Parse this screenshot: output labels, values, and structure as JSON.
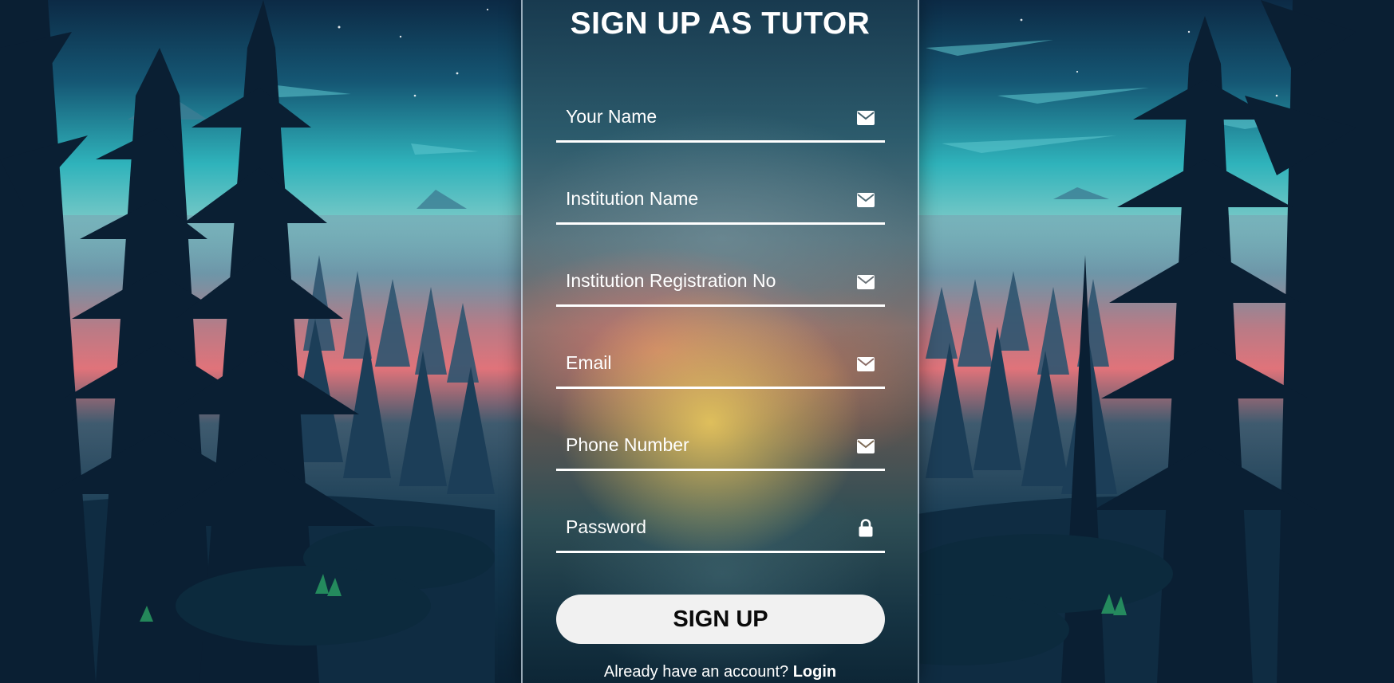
{
  "form": {
    "title": "SIGN UP AS TUTOR",
    "fields": [
      {
        "placeholder": "Your Name",
        "icon": "envelope-icon",
        "type": "text"
      },
      {
        "placeholder": "Institution Name",
        "icon": "envelope-icon",
        "type": "text"
      },
      {
        "placeholder": "Institution Registration No",
        "icon": "envelope-icon",
        "type": "text"
      },
      {
        "placeholder": "Email",
        "icon": "envelope-icon",
        "type": "email"
      },
      {
        "placeholder": "Phone Number",
        "icon": "envelope-icon",
        "type": "tel"
      },
      {
        "placeholder": "Password",
        "icon": "lock-icon",
        "type": "password"
      }
    ],
    "submit_label": "SIGN UP",
    "login_prompt": "Already have an account?",
    "login_link": "Login"
  },
  "colors": {
    "text": "#ffffff",
    "button_bg": "#f1f1f1",
    "button_text": "#0a0a0a",
    "sky_top": "#0d2f4a",
    "sky_glow": "#3cc3c8",
    "sunset": "#e0737a"
  }
}
